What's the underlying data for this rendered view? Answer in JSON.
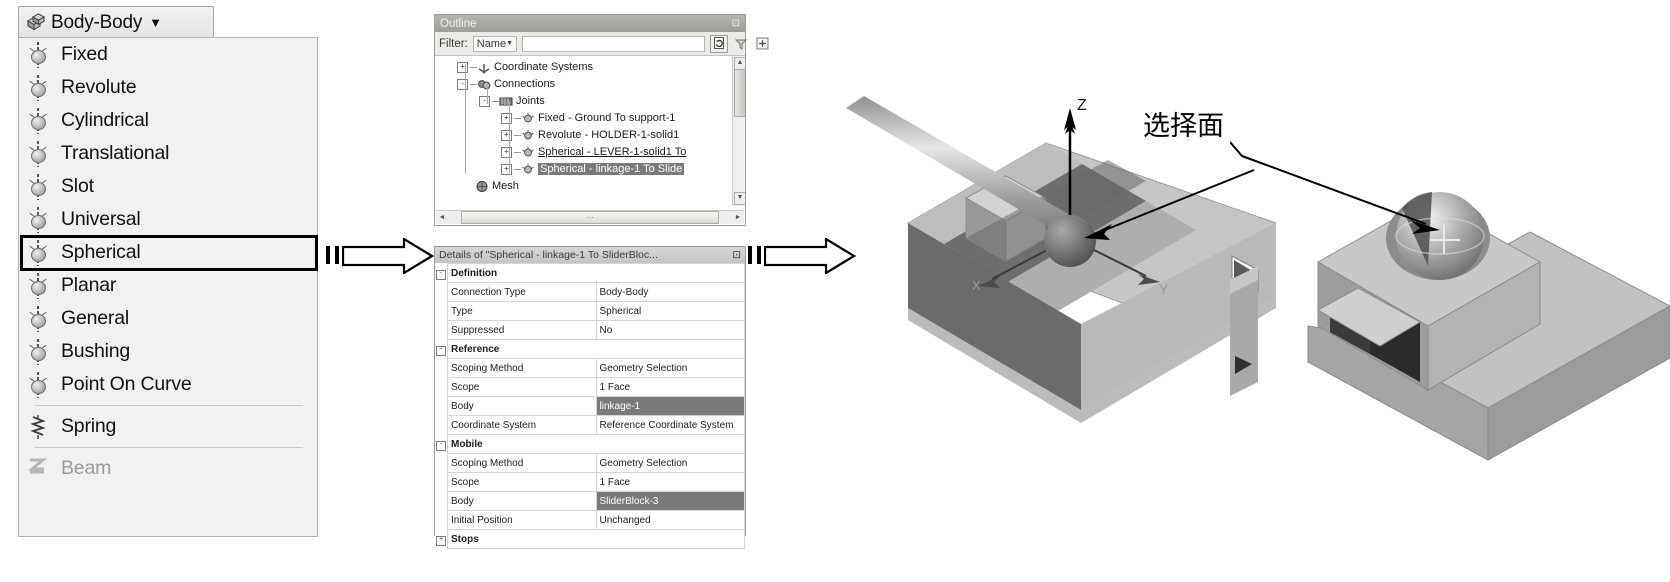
{
  "joint_menu": {
    "button_label": "Body-Body",
    "button_icon": "bodies-icon",
    "caret_icon": "chevron-down-icon",
    "selected_item": "Spherical",
    "items": [
      {
        "label": "Fixed",
        "icon": "joint-icon",
        "disabled": false,
        "separator_after": false
      },
      {
        "label": "Revolute",
        "icon": "joint-icon",
        "disabled": false,
        "separator_after": false
      },
      {
        "label": "Cylindrical",
        "icon": "joint-icon",
        "disabled": false,
        "separator_after": false
      },
      {
        "label": "Translational",
        "icon": "joint-icon",
        "disabled": false,
        "separator_after": false
      },
      {
        "label": "Slot",
        "icon": "joint-icon",
        "disabled": false,
        "separator_after": false
      },
      {
        "label": "Universal",
        "icon": "joint-icon",
        "disabled": false,
        "separator_after": false
      },
      {
        "label": "Spherical",
        "icon": "joint-icon",
        "disabled": false,
        "separator_after": false
      },
      {
        "label": "Planar",
        "icon": "joint-icon",
        "disabled": false,
        "separator_after": false
      },
      {
        "label": "General",
        "icon": "joint-icon",
        "disabled": false,
        "separator_after": false
      },
      {
        "label": "Bushing",
        "icon": "joint-icon",
        "disabled": false,
        "separator_after": false
      },
      {
        "label": "Point On Curve",
        "icon": "joint-icon",
        "disabled": false,
        "separator_after": true
      },
      {
        "label": "Spring",
        "icon": "spring-icon",
        "disabled": false,
        "separator_after": true
      },
      {
        "label": "Beam",
        "icon": "beam-icon",
        "disabled": true,
        "separator_after": false
      }
    ]
  },
  "outline": {
    "title": "Outline",
    "pin_icon": "pin-icon",
    "filter": {
      "label": "Filter:",
      "mode": "Name",
      "mode_caret_icon": "chevron-down-icon",
      "value": "",
      "buttons": [
        "refresh-icon",
        "clear-filter-icon",
        "expand-icon"
      ]
    },
    "tree": [
      {
        "label": "Coordinate Systems",
        "indent": 0,
        "icon": "coordinate-systems-icon",
        "expander": "+",
        "state": "normal"
      },
      {
        "label": "Connections",
        "indent": 0,
        "icon": "connections-icon",
        "expander": "-",
        "state": "normal"
      },
      {
        "label": "Joints",
        "indent": 1,
        "icon": "joints-icon",
        "expander": "-",
        "state": "normal"
      },
      {
        "label": "Fixed - Ground To support-1",
        "indent": 2,
        "icon": "joint-icon",
        "expander": "+",
        "state": "normal"
      },
      {
        "label": "Revolute - HOLDER-1-solid1",
        "indent": 2,
        "icon": "joint-icon",
        "expander": "+",
        "state": "normal"
      },
      {
        "label": "Spherical - LEVER-1-solid1 To",
        "indent": 2,
        "icon": "joint-icon",
        "expander": "+",
        "state": "underline"
      },
      {
        "label": "Spherical - linkage-1 To Slide",
        "indent": 2,
        "icon": "joint-icon",
        "expander": "+",
        "state": "selected"
      },
      {
        "label": "Mesh",
        "indent": 0,
        "icon": "mesh-icon",
        "expander": "",
        "state": "normal"
      }
    ],
    "hscroll_glyph": "⋯",
    "hscroll_left_icon": "scroll-left-icon",
    "hscroll_right_icon": "scroll-right-icon"
  },
  "details": {
    "title": "Details of \"Spherical - linkage-1 To SliderBloc...",
    "pin_icon": "pin-icon",
    "rows": [
      {
        "type": "group",
        "gutter": "-",
        "label": "Definition"
      },
      {
        "type": "row",
        "key": "Connection Type",
        "value": "Body-Body",
        "highlight": false
      },
      {
        "type": "row",
        "key": "Type",
        "value": "Spherical",
        "highlight": false
      },
      {
        "type": "row",
        "key": "Suppressed",
        "value": "No",
        "highlight": false
      },
      {
        "type": "group",
        "gutter": "-",
        "label": "Reference"
      },
      {
        "type": "row",
        "key": "Scoping Method",
        "value": "Geometry Selection",
        "highlight": false
      },
      {
        "type": "row",
        "key": "Scope",
        "value": "1 Face",
        "highlight": false
      },
      {
        "type": "row",
        "key": "Body",
        "value": "linkage-1",
        "highlight": true
      },
      {
        "type": "row",
        "key": "Coordinate System",
        "value": "Reference Coordinate System",
        "highlight": false
      },
      {
        "type": "group",
        "gutter": "-",
        "label": "Mobile"
      },
      {
        "type": "row",
        "key": "Scoping Method",
        "value": "Geometry Selection",
        "highlight": false
      },
      {
        "type": "row",
        "key": "Scope",
        "value": "1 Face",
        "highlight": false
      },
      {
        "type": "row",
        "key": "Body",
        "value": "SliderBlock-3",
        "highlight": true
      },
      {
        "type": "row",
        "key": "Initial Position",
        "value": "Unchanged",
        "highlight": false
      },
      {
        "type": "group",
        "gutter": "+",
        "label": "Stops"
      }
    ]
  },
  "flow": {
    "arrow1_icon": "block-arrow-right-icon",
    "arrow2_icon": "block-arrow-right-icon"
  },
  "figures": {
    "annotation": "选择面",
    "axis_z": "Z",
    "axis_y": "Y",
    "axis_x": "X",
    "left_view_name": "slider-rail-spherical-joint-view",
    "right_view_name": "slider-block-ball-face-view",
    "leader_icon": "leader-arrow-icon"
  },
  "colors": {
    "menu_bg": "#f1f1ef",
    "panel_border": "#9c9c98",
    "selection_gray": "#7a7a7a",
    "title_bar": "#a8a8a4",
    "metal_light": "#c9c9c9",
    "metal_mid": "#a0a0a0",
    "metal_dark": "#6e6e6e"
  }
}
